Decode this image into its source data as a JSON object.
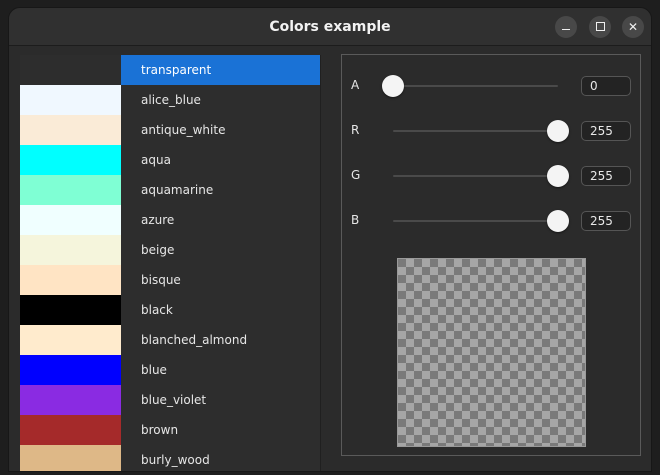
{
  "window": {
    "title": "Colors example"
  },
  "titlebar_buttons": [
    "minimize",
    "maximize",
    "close"
  ],
  "color_list": {
    "selected": "transparent",
    "items": [
      {
        "name": "transparent",
        "hex": "transparent"
      },
      {
        "name": "alice_blue",
        "hex": "#f0f8ff"
      },
      {
        "name": "antique_white",
        "hex": "#faebd7"
      },
      {
        "name": "aqua",
        "hex": "#00ffff"
      },
      {
        "name": "aquamarine",
        "hex": "#7fffd4"
      },
      {
        "name": "azure",
        "hex": "#f0ffff"
      },
      {
        "name": "beige",
        "hex": "#f5f5dc"
      },
      {
        "name": "bisque",
        "hex": "#ffe4c4"
      },
      {
        "name": "black",
        "hex": "#000000"
      },
      {
        "name": "blanched_almond",
        "hex": "#ffebcd"
      },
      {
        "name": "blue",
        "hex": "#0000ff"
      },
      {
        "name": "blue_violet",
        "hex": "#8a2be2"
      },
      {
        "name": "brown",
        "hex": "#a52a2a"
      },
      {
        "name": "burly_wood",
        "hex": "#deb887"
      }
    ]
  },
  "sliders": [
    {
      "channel": "A",
      "value": "0",
      "level": 0
    },
    {
      "channel": "R",
      "value": "255",
      "level": 1
    },
    {
      "channel": "G",
      "value": "255",
      "level": 1
    },
    {
      "channel": "B",
      "value": "255",
      "level": 1
    }
  ],
  "preview": {
    "rgba": "rgba(255,255,255,0)"
  },
  "colors": {
    "selection": "#1a72d6",
    "thumb": "#f4f4f4"
  }
}
